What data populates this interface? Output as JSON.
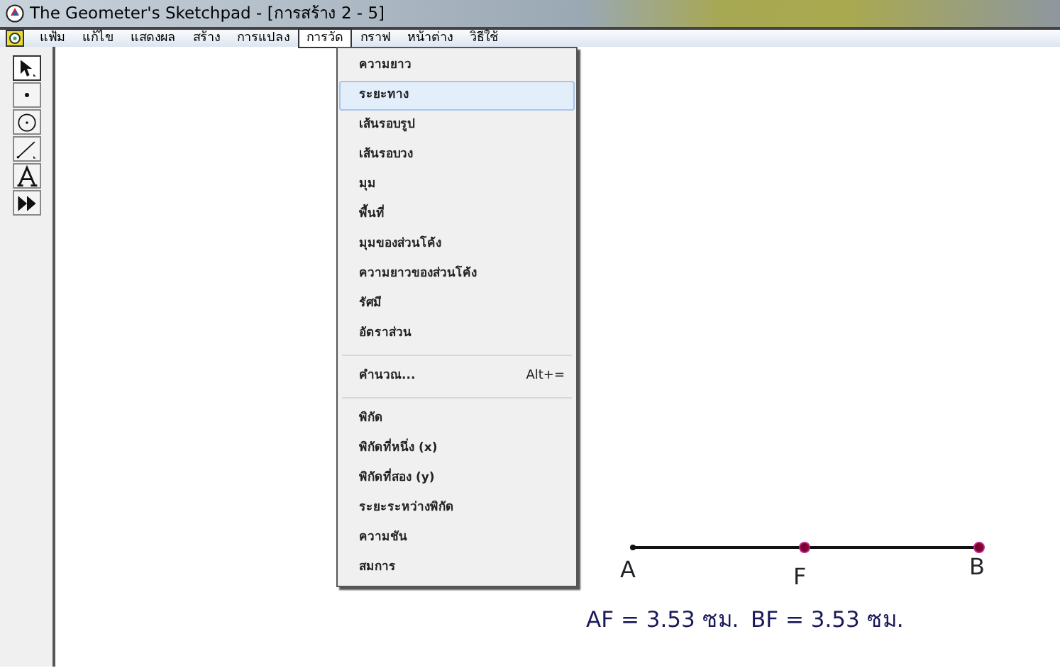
{
  "window": {
    "title": "The Geometer's Sketchpad - [การสร้าง 2 - 5]"
  },
  "menubar": [
    {
      "label": "แฟ้ม",
      "selected": false
    },
    {
      "label": "แก้ไข",
      "selected": false
    },
    {
      "label": "แสดงผล",
      "selected": false
    },
    {
      "label": "สร้าง",
      "selected": false
    },
    {
      "label": "การแปลง",
      "selected": false
    },
    {
      "label": "การวัด",
      "selected": true
    },
    {
      "label": "กราฟ",
      "selected": false
    },
    {
      "label": "หน้าต่าง",
      "selected": false
    },
    {
      "label": "วิธีใช้",
      "selected": false
    }
  ],
  "toolbox": [
    {
      "kind": "arrow",
      "selected": true
    },
    {
      "kind": "point",
      "selected": false
    },
    {
      "kind": "compass",
      "selected": false
    },
    {
      "kind": "line",
      "selected": false
    },
    {
      "kind": "text",
      "selected": false
    },
    {
      "kind": "custom",
      "selected": false
    }
  ],
  "menu": [
    {
      "kind": "item",
      "label": "ความยาว",
      "selected": false
    },
    {
      "kind": "item",
      "label": "ระยะทาง",
      "selected": true
    },
    {
      "kind": "item",
      "label": "เส้นรอบรูป",
      "selected": false
    },
    {
      "kind": "item",
      "label": "เส้นรอบวง",
      "selected": false
    },
    {
      "kind": "item",
      "label": "มุม",
      "selected": false
    },
    {
      "kind": "item",
      "label": "พื้นที่",
      "selected": false
    },
    {
      "kind": "item",
      "label": "มุมของส่วนโค้ง",
      "selected": false
    },
    {
      "kind": "item",
      "label": "ความยาวของส่วนโค้ง",
      "selected": false
    },
    {
      "kind": "item",
      "label": "รัศมี",
      "selected": false
    },
    {
      "kind": "item",
      "label": "อัตราส่วน",
      "selected": false
    },
    {
      "kind": "separator"
    },
    {
      "kind": "item",
      "label": "คำนวณ...",
      "shortcut": "Alt+=",
      "selected": false
    },
    {
      "kind": "separator"
    },
    {
      "kind": "item",
      "label": "พิกัด",
      "selected": false
    },
    {
      "kind": "item",
      "label": "พิกัดที่หนึ่ง (x)",
      "selected": false
    },
    {
      "kind": "item",
      "label": "พิกัดที่สอง (y)",
      "selected": false
    },
    {
      "kind": "item",
      "label": "ระยะระหว่างพิกัด",
      "selected": false
    },
    {
      "kind": "item",
      "label": "ความชัน",
      "selected": false
    },
    {
      "kind": "item",
      "label": "สมการ",
      "selected": false
    }
  ],
  "sketch": {
    "points": [
      {
        "label": "A",
        "kind": "plain"
      },
      {
        "label": "F",
        "kind": "marked"
      },
      {
        "label": "B",
        "kind": "marked"
      }
    ],
    "measurements": [
      "AF = 3.53 ซม.",
      "BF = 3.53 ซม."
    ]
  }
}
